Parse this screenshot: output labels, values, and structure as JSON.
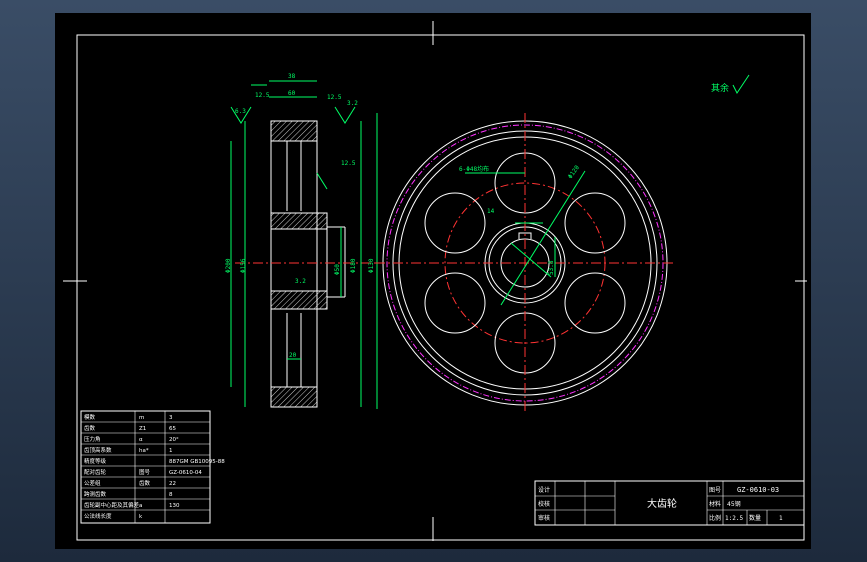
{
  "drawing": {
    "title_block": {
      "part_name": "大齿轮",
      "drawing_no": "GZ-0610-03",
      "material": "45钢",
      "scale": "1:2.5",
      "quantity": "1",
      "labels": {
        "design": "设计",
        "check": "校核",
        "approve": "审核",
        "drawing_no": "图号",
        "material": "材料",
        "scale": "比例",
        "quantity": "数量"
      }
    },
    "param_table": [
      [
        "模数",
        "m",
        "3"
      ],
      [
        "齿数",
        "Z1",
        "65"
      ],
      [
        "压力角",
        "α",
        "20°"
      ],
      [
        "齿顶高系数",
        "ha*",
        "1"
      ],
      [
        "精度等级",
        "",
        "887GM GB10095-88"
      ],
      [
        "配对齿轮",
        "图号",
        "GZ-0610-04"
      ],
      [
        "公差组",
        "齿数",
        "22"
      ],
      [
        "跨测齿数",
        "",
        "8"
      ],
      [
        "齿轮副中心距及其偏差",
        "a",
        "130"
      ],
      [
        "公法线长度",
        "k",
        ""
      ]
    ],
    "roughness_note": "其余",
    "dims_side": {
      "width_top": "38",
      "hub_width": "60",
      "ra_1": "6.3",
      "ra_2": "12.5",
      "ra_3": "12.5",
      "ra_4": "3.2",
      "ra_5": "12.5",
      "ra_6": "3.2",
      "bore_ra": "3.2",
      "d_outer": "Φ200",
      "d_rim_inner": "Φ156",
      "d_hub": "Φ180",
      "d_hub2": "Φ130",
      "d_bore": "Φ50",
      "rib_width": "20"
    },
    "dims_front": {
      "holes_note": "6-Φ48均布",
      "pcd": "Φ120",
      "keyway": "14",
      "key_depth": "53.8"
    }
  }
}
